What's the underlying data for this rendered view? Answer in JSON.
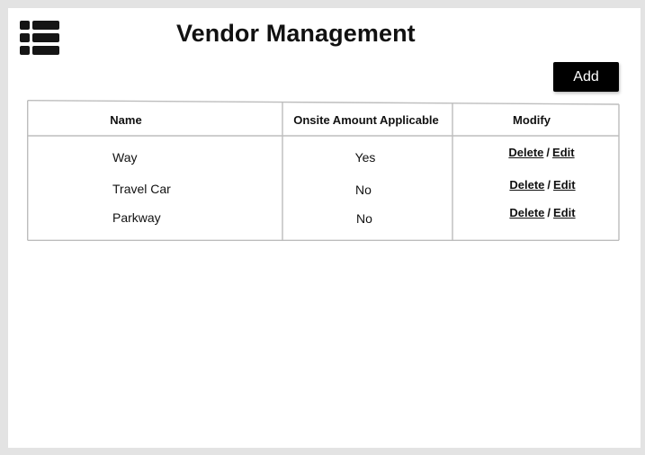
{
  "header": {
    "title": "Vendor Management",
    "menu_icon": "table-list-icon"
  },
  "toolbar": {
    "add_label": "Add"
  },
  "table": {
    "columns": [
      "Name",
      "Onsite Amount Applicable",
      "Modify"
    ],
    "rows": [
      {
        "name": "Way",
        "onsite": "Yes",
        "delete_label": "Delete",
        "separator": "/",
        "edit_label": "Edit"
      },
      {
        "name": "Travel Car",
        "onsite": "No",
        "delete_label": "Delete",
        "separator": "/",
        "edit_label": "Edit"
      },
      {
        "name": "Parkway",
        "onsite": "No",
        "delete_label": "Delete",
        "separator": "/",
        "edit_label": "Edit"
      }
    ]
  },
  "colors": {
    "background": "#e3e3e3",
    "canvas": "#ffffff",
    "button": "#000000",
    "button_text": "#ffffff",
    "text": "#111111",
    "border": "#bdbdbd"
  }
}
